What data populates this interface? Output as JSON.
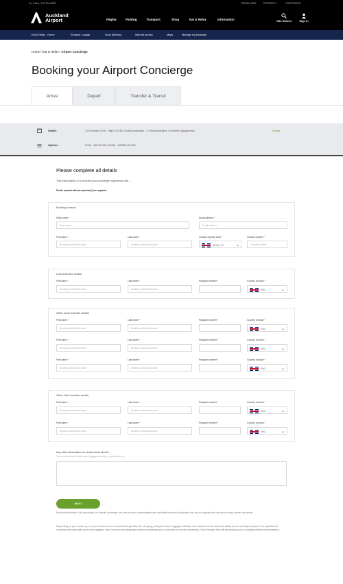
{
  "utility_bar": {
    "left": "Fri, 8 Dec, 2:03 PM NZST",
    "links": [
      "TRAVELLERS",
      "PROPERTY",
      "CORPORATE"
    ]
  },
  "brand": {
    "line1": "Auckland",
    "line2": "Airport"
  },
  "main_nav": [
    "Flights",
    "Parking",
    "Transport",
    "Shop",
    "Eat & Relax",
    "Information"
  ],
  "nav_icons": {
    "search": "Site Search",
    "signin": "Sign in"
  },
  "sub_nav": [
    "Eat & Relax - Home",
    "Emperor Lounge",
    "Food directory",
    "Internet access",
    "Maps",
    "Manage my bookings"
  ],
  "breadcrumb": {
    "home": "Home",
    "sep1": "/",
    "parent": "Eat & Relax",
    "sep2": "/",
    "current": "Airport Concierge"
  },
  "page_title": "Booking your Airport Concierge",
  "tabs": [
    "Arrive",
    "Depart",
    "Transfer & Transit"
  ],
  "summary": {
    "details_label": "Details",
    "details_value": "12 December 2018 - Flight LH2158, 3 Adult passengers , 2 Child passengers, 5 checked luggage items",
    "change": "Change",
    "options_label": "Options",
    "options_value": "Porter - $44.00 NZD, Shuttle - NZD$44.00 NZD"
  },
  "form": {
    "heading": "Please complete all details",
    "intro": "This information is to ensure your concierge experience will ...",
    "required_note": "Fields marked with an asterisk(*) are required",
    "booking_contact": {
      "title": "Booking contact",
      "party_label": "Party name",
      "party_ph": "Party name",
      "email_label": "Email address",
      "email_ph": "Email address",
      "first_label": "First name",
      "first_ph": "Booking contact first name",
      "last_label": "Last name",
      "last_ph": "Booking contact last name",
      "ccode_label": "Contact country code",
      "ccode_value": "(ENG) +44",
      "cnum_label": "Contact number",
      "cnum_ph": "Contact number"
    },
    "lead": {
      "title": "Lead traveller details"
    },
    "adult": {
      "title": "Other adult traveller details"
    },
    "child": {
      "title": "Other child traveller details"
    },
    "traveller_labels": {
      "first": "First name",
      "last": "Last name",
      "passport": "Passport number",
      "country": "Country of issue",
      "first_ph": "Booking contact first name",
      "last_ph": "Booking contact last name",
      "country_value": "ENG"
    },
    "star": "*",
    "other_info_label": "Any other information we should know about?",
    "other_info_hint": "This could include details about luggage mobility or medication etc.",
    "next": "NEXT",
    "fine1": "Booking information: We graciously our friendly concierge who can provide a personalised and dedicated service looking after you at your airports and assure an away, stress free arrival.",
    "fine2": "Depending on your needs, you or your concier can be escorted through duty free shopping, passport control, luggage collection and customs and be delivered safely to your awaiting transport. Our experienced concierge will assist with your hand baggage, help overcome any language barriers and prepare you in advance for border processing. Once through, they will accompany you to awaiting kerbside transportation."
  }
}
